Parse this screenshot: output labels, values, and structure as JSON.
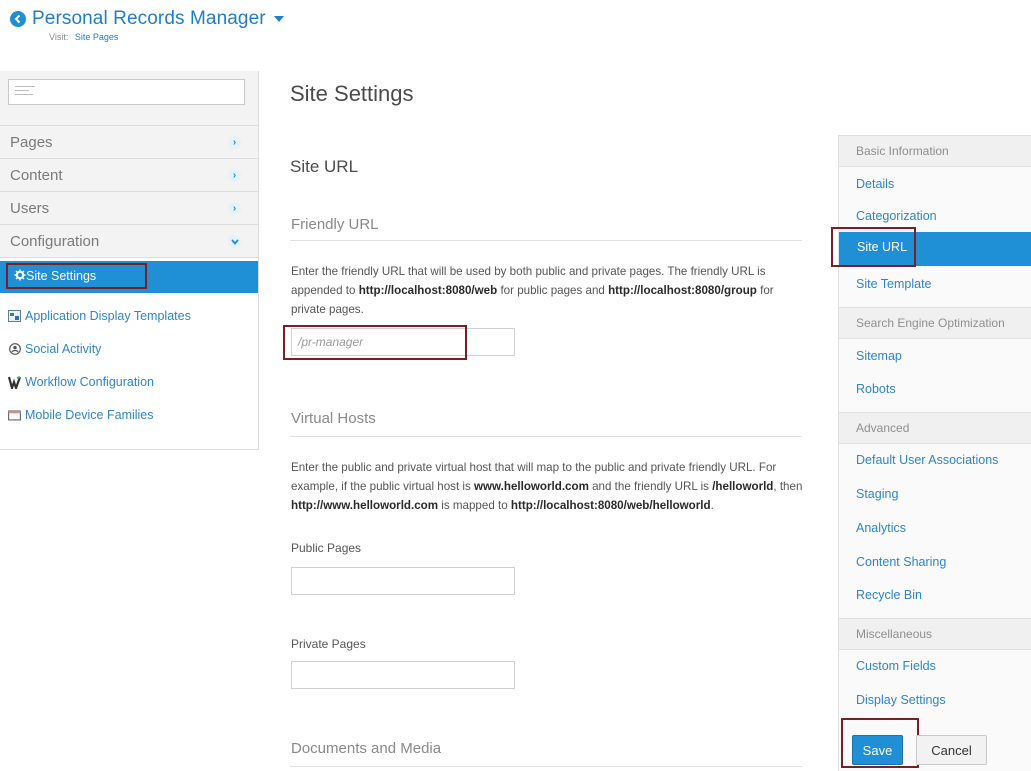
{
  "header": {
    "title": "Personal Records Manager",
    "visit_label": "Visit:",
    "visit_link": "Site Pages"
  },
  "sidebar": {
    "nav": [
      {
        "label": "Pages",
        "icon": "chevron-right-icon"
      },
      {
        "label": "Content",
        "icon": "chevron-right-icon"
      },
      {
        "label": "Users",
        "icon": "chevron-right-icon"
      },
      {
        "label": "Configuration",
        "icon": "chevron-down-icon"
      }
    ],
    "config_items": [
      {
        "label": "Site Settings",
        "icon": "gear-icon",
        "active": true
      },
      {
        "label": "Application Display Templates",
        "icon": "template-icon"
      },
      {
        "label": "Social Activity",
        "icon": "social-icon"
      },
      {
        "label": "Workflow Configuration",
        "icon": "workflow-icon"
      },
      {
        "label": "Mobile Device Families",
        "icon": "device-icon"
      }
    ]
  },
  "main": {
    "page_title": "Site Settings",
    "section_title": "Site URL",
    "friendly_url": {
      "heading": "Friendly URL",
      "text_1": "Enter the friendly URL that will be used by both public and private pages. The friendly URL is appended to ",
      "url_web": "http://localhost:8080/web",
      "text_2": " for public pages and ",
      "url_group": "http://localhost:8080/group",
      "text_3": " for private pages.",
      "input_placeholder": "/pr-manager"
    },
    "virtual_hosts": {
      "heading": "Virtual Hosts",
      "text_1": "Enter the public and private virtual host that will map to the public and private friendly URL. For example, if the public virtual host is ",
      "host": "www.helloworld.com",
      "text_2": " and the friendly URL is ",
      "path": "/helloworld",
      "text_3": ", then ",
      "host_url": "http://www.helloworld.com",
      "text_4": " is mapped to ",
      "mapped_url": "http://localhost:8080/web/helloworld",
      "text_5": ".",
      "public_label": "Public Pages",
      "private_label": "Private Pages"
    },
    "documents_heading": "Documents and Media"
  },
  "right_nav": {
    "basic_information": {
      "heading": "Basic Information",
      "items": [
        "Details",
        "Categorization",
        "Site URL",
        "Site Template"
      ]
    },
    "seo": {
      "heading": "Search Engine Optimization",
      "items": [
        "Sitemap",
        "Robots"
      ]
    },
    "advanced": {
      "heading": "Advanced",
      "items": [
        "Default User Associations",
        "Staging",
        "Analytics",
        "Content Sharing",
        "Recycle Bin"
      ]
    },
    "misc": {
      "heading": "Miscellaneous",
      "items": [
        "Custom Fields",
        "Display Settings"
      ]
    },
    "save_label": "Save",
    "cancel_label": "Cancel"
  },
  "colors": {
    "accent": "#1f8fd6",
    "highlight_border": "#7b1f24"
  }
}
